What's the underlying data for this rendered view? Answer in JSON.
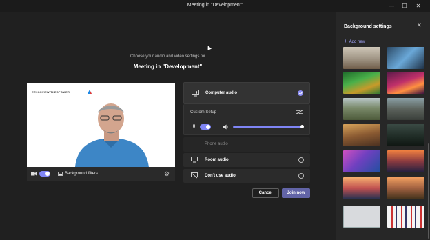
{
  "window": {
    "title": "Meeting in \"Development\"",
    "controls": {
      "minimize": "—",
      "maximize": "☐",
      "close": "✕"
    }
  },
  "prejoin": {
    "intro": "Choose your audio and video settings for",
    "meeting_title": "Meeting in \"Development\""
  },
  "video": {
    "logo_text": "ETHOSVIEW THEOPOWER",
    "camera_on": true,
    "background_filters_label": "Background filters"
  },
  "audio_options": {
    "computer_audio": {
      "label": "Computer audio",
      "selected": true
    },
    "custom_setup": {
      "label": "Custom Setup",
      "mic_on": true,
      "speaker_volume": 0.97
    },
    "phone_audio": {
      "label": "Phone audio"
    },
    "room_audio": {
      "label": "Room audio"
    },
    "dont_use_audio": {
      "label": "Don't use audio"
    }
  },
  "actions": {
    "cancel_label": "Cancel",
    "join_label": "Join now"
  },
  "background_panel": {
    "title": "Background settings",
    "add_new_label": "Add new",
    "thumbnails": [
      "room-interior",
      "blue-office",
      "game-world-green",
      "magenta-fantasy",
      "mountain-valley",
      "rocky-landscape",
      "desert-canyon",
      "dark-forest-path",
      "pink-sky-field",
      "sunset-city",
      "anime-sunset",
      "orange-mountains",
      "light-grey-blank",
      "logo-wall"
    ]
  },
  "colors": {
    "accent": "#6264a7",
    "toggle": "#7f85f5",
    "background": "#202020",
    "panel": "#272727"
  }
}
